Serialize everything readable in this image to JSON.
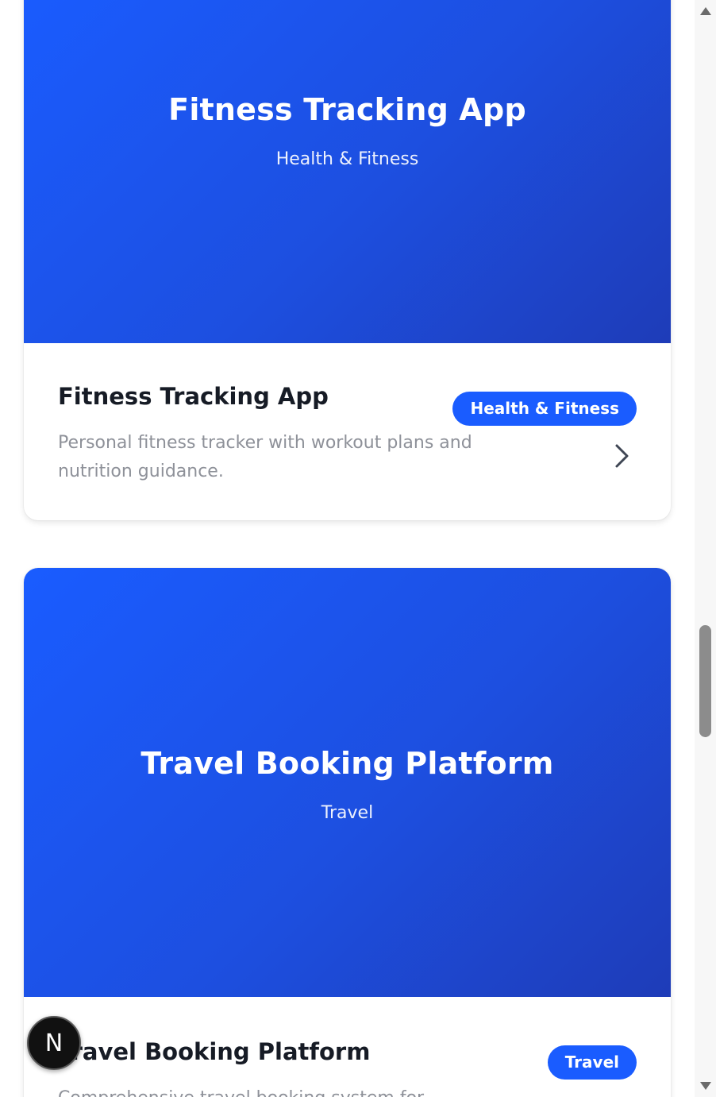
{
  "projects": [
    {
      "hero_title": "Fitness Tracking App",
      "hero_subtitle": "Health & Fitness",
      "title": "Fitness Tracking App",
      "description": "Personal fitness tracker with workout plans and nutrition guidance.",
      "category_badge": "Health & Fitness"
    },
    {
      "hero_title": "Travel Booking Platform",
      "hero_subtitle": "Travel",
      "title": "Travel Booking Platform",
      "description": "Comprehensive travel booking system for flights, hotels",
      "category_badge": "Travel"
    }
  ],
  "dev_indicator": {
    "label": "N"
  },
  "colors": {
    "accent": "#1a5cff",
    "hero_gradient_start": "#1a5cff",
    "hero_gradient_end": "#1e3cb8",
    "title_text": "#161b25",
    "description_text": "#8e9199"
  },
  "icons": {
    "card_arrow": "chevron-right-icon",
    "scroll_up": "triangle-up-icon",
    "scroll_down": "triangle-down-icon"
  }
}
